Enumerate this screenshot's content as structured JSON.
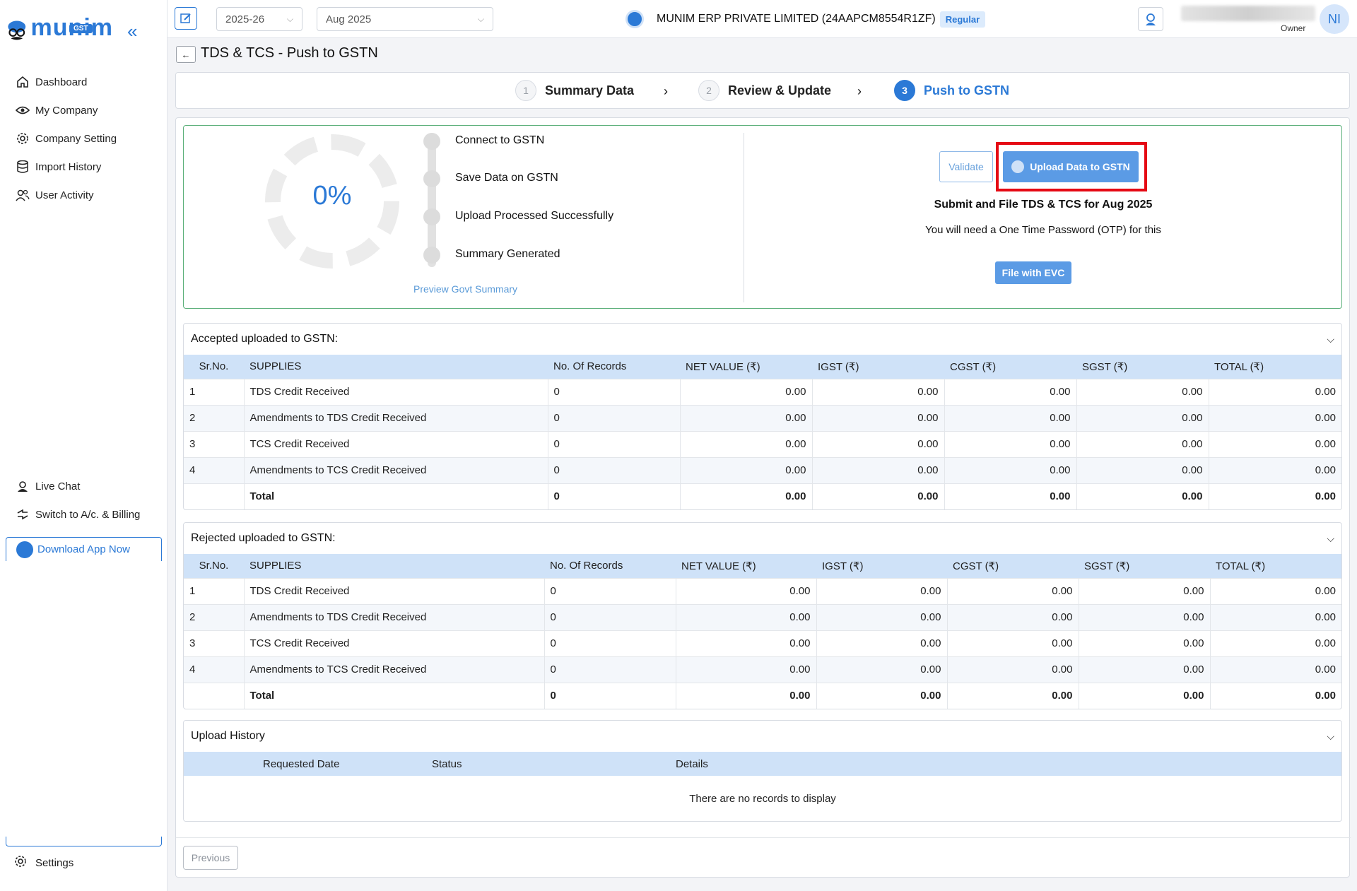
{
  "sidebar": {
    "logo_text": "munim",
    "logo_badge": "GST",
    "nav": [
      {
        "label": "Dashboard"
      },
      {
        "label": "My Company"
      },
      {
        "label": "Company Setting"
      },
      {
        "label": "Import History"
      },
      {
        "label": "User Activity"
      }
    ],
    "live_chat": "Live Chat",
    "switch_billing": "Switch to A/c. & Billing",
    "download_app": "Download App Now",
    "settings": "Settings"
  },
  "topbar": {
    "financial_year": "2025-26",
    "period": "Aug 2025",
    "company_name": "MUNIM ERP PRIVATE LIMITED (24AAPCM8554R1ZF)",
    "company_type": "Regular",
    "user_role": "Owner",
    "avatar_initials": "NI"
  },
  "page": {
    "title": "TDS & TCS - Push to GSTN"
  },
  "stepper": [
    {
      "num": "1",
      "label": "Summary Data"
    },
    {
      "num": "2",
      "label": "Review & Update"
    },
    {
      "num": "3",
      "label": "Push to GSTN"
    }
  ],
  "status": {
    "percent": "0%",
    "steps": [
      "Connect to GSTN",
      "Save Data on GSTN",
      "Upload Processed Successfully",
      "Summary Generated"
    ],
    "preview_link": "Preview Govt Summary",
    "validate_label": "Validate",
    "upload_label": "Upload Data to GSTN",
    "submit_title": "Submit and File TDS & TCS for Aug 2025",
    "otp_note": "You will need a One Time Password (OTP) for this",
    "evc_label": "File with EVC"
  },
  "accepted": {
    "title": "Accepted uploaded to GSTN:",
    "headers": [
      "Sr.No.",
      "SUPPLIES",
      "No. Of Records",
      "NET VALUE (₹)",
      "IGST (₹)",
      "CGST (₹)",
      "SGST (₹)",
      "TOTAL (₹)"
    ],
    "rows": [
      [
        "1",
        "TDS Credit Received",
        "0",
        "0.00",
        "0.00",
        "0.00",
        "0.00",
        "0.00"
      ],
      [
        "2",
        "Amendments to TDS Credit Received",
        "0",
        "0.00",
        "0.00",
        "0.00",
        "0.00",
        "0.00"
      ],
      [
        "3",
        "TCS Credit Received",
        "0",
        "0.00",
        "0.00",
        "0.00",
        "0.00",
        "0.00"
      ],
      [
        "4",
        "Amendments to TCS Credit Received",
        "0",
        "0.00",
        "0.00",
        "0.00",
        "0.00",
        "0.00"
      ],
      [
        "",
        "Total",
        "0",
        "0.00",
        "0.00",
        "0.00",
        "0.00",
        "0.00"
      ]
    ]
  },
  "rejected": {
    "title": "Rejected uploaded to GSTN:",
    "headers": [
      "Sr.No.",
      "SUPPLIES",
      "No. Of Records",
      "NET VALUE (₹)",
      "IGST (₹)",
      "CGST (₹)",
      "SGST (₹)",
      "TOTAL (₹)"
    ],
    "rows": [
      [
        "1",
        "TDS Credit Received",
        "0",
        "0.00",
        "0.00",
        "0.00",
        "0.00",
        "0.00"
      ],
      [
        "2",
        "Amendments to TDS Credit Received",
        "0",
        "0.00",
        "0.00",
        "0.00",
        "0.00",
        "0.00"
      ],
      [
        "3",
        "TCS Credit Received",
        "0",
        "0.00",
        "0.00",
        "0.00",
        "0.00",
        "0.00"
      ],
      [
        "4",
        "Amendments to TCS Credit Received",
        "0",
        "0.00",
        "0.00",
        "0.00",
        "0.00",
        "0.00"
      ],
      [
        "",
        "Total",
        "0",
        "0.00",
        "0.00",
        "0.00",
        "0.00",
        "0.00"
      ]
    ]
  },
  "history": {
    "title": "Upload History",
    "headers": [
      "Requested Date",
      "Status",
      "Details"
    ],
    "empty": "There are no records to display"
  },
  "footer": {
    "previous_label": "Previous"
  }
}
